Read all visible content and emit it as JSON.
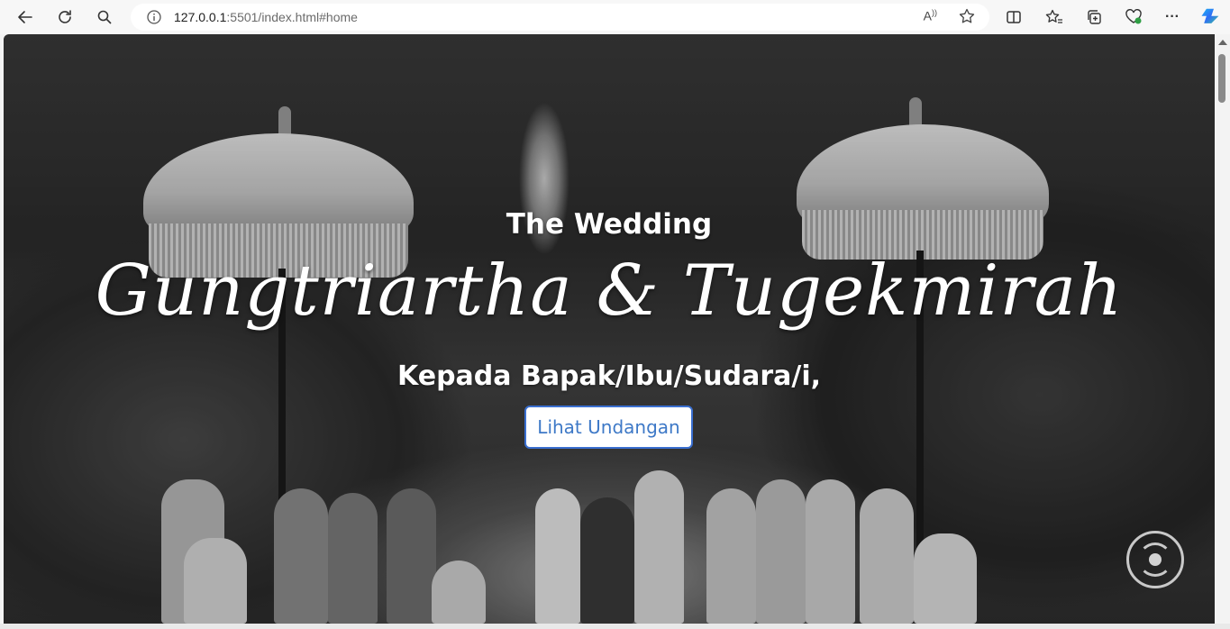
{
  "browser": {
    "url_host": "127.0.0.1",
    "url_rest": ":5501/index.html#home",
    "icons": {
      "back": "back-arrow-icon",
      "refresh": "refresh-icon",
      "search": "search-icon",
      "info": "info-icon",
      "read_aloud": "read-aloud-icon",
      "favorite": "star-icon",
      "split": "split-screen-icon",
      "favorites": "favorites-icon",
      "collections": "collections-icon",
      "extensions": "browser-essentials-icon",
      "more": "more-icon",
      "copilot": "copilot-icon"
    },
    "read_aloud_label": "A",
    "more_label": "···"
  },
  "hero": {
    "pre_title": "The Wedding",
    "couple_names": "Gungtriartha & Tugekmirah",
    "greeting": "Kepada Bapak/Ibu/Sudara/i,",
    "cta_label": "Lihat Undangan",
    "colors": {
      "cta_text": "#3e79c7",
      "cta_border": "#3a6fd0",
      "title_text": "#ffffff"
    }
  },
  "music_button": {
    "icon": "music-disc-icon"
  }
}
